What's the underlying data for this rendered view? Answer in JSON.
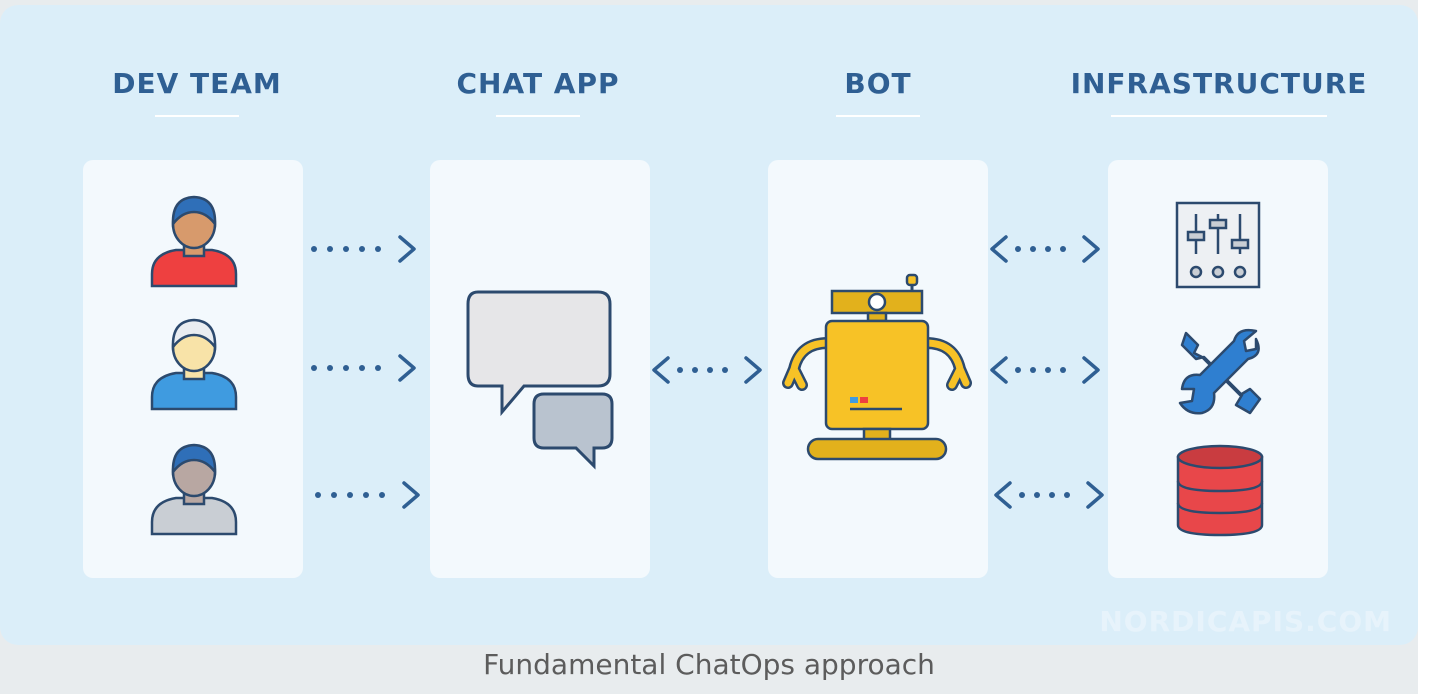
{
  "columns": [
    {
      "title": "DEV TEAM"
    },
    {
      "title": "CHAT APP"
    },
    {
      "title": "BOT"
    },
    {
      "title": "INFRASTRUCTURE"
    }
  ],
  "icons": {
    "dev_team": [
      "developer-red-icon",
      "developer-blue-icon",
      "developer-gray-icon"
    ],
    "chat_app": "chat-bubbles-icon",
    "bot": "robot-icon",
    "infrastructure": [
      "control-panel-icon",
      "tools-icon",
      "database-icon"
    ]
  },
  "connections": [
    {
      "from": "DEV TEAM",
      "to": "CHAT APP",
      "direction": "one-way"
    },
    {
      "from": "DEV TEAM",
      "to": "CHAT APP",
      "direction": "one-way"
    },
    {
      "from": "DEV TEAM",
      "to": "CHAT APP",
      "direction": "one-way"
    },
    {
      "from": "CHAT APP",
      "to": "BOT",
      "direction": "two-way"
    },
    {
      "from": "BOT",
      "to": "INFRASTRUCTURE",
      "direction": "two-way"
    },
    {
      "from": "BOT",
      "to": "INFRASTRUCTURE",
      "direction": "two-way"
    },
    {
      "from": "BOT",
      "to": "INFRASTRUCTURE",
      "direction": "two-way"
    }
  ],
  "colors": {
    "background": "#dbeef9",
    "card": "#f3f9fd",
    "title": "#2f5f93",
    "arrow": "#2f5f93",
    "robot": "#f7c226",
    "database": "#e8474a"
  },
  "watermark": "NORDICAPIS.COM",
  "caption": "Fundamental ChatOps approach"
}
